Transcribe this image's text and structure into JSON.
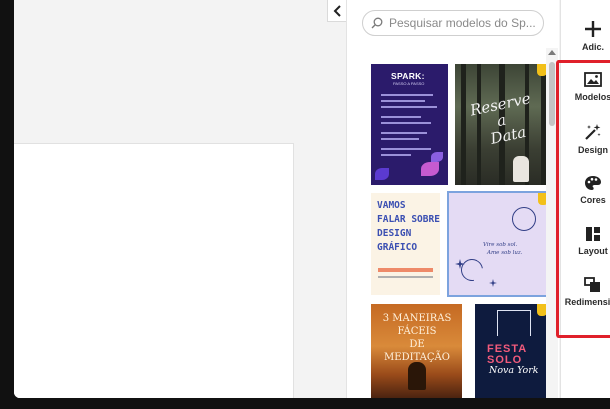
{
  "search": {
    "placeholder": "Pesquisar modelos do Sp..."
  },
  "rail": {
    "add_label": "Adic.",
    "items": [
      {
        "label": "Modelos",
        "icon": "image-icon"
      },
      {
        "label": "Design",
        "icon": "magic-wand-icon"
      },
      {
        "label": "Cores",
        "icon": "palette-icon"
      },
      {
        "label": "Layout",
        "icon": "layout-icon"
      },
      {
        "label": "Redimension",
        "icon": "resize-icon"
      }
    ]
  },
  "templates": {
    "spark": {
      "title_line1": "SPARK:",
      "title_line2": "PASSO A PASSO"
    },
    "forest": {
      "script_line1": "Reserve",
      "script_line2": "a",
      "script_line3": "Data"
    },
    "design": {
      "lines": [
        "VAMOS",
        "FALAR SOBRE",
        "DESIGN",
        "GRÁFICO"
      ]
    },
    "moon": {
      "quote_line1": "Vire sob sol.",
      "quote_line2": "Ame sob luz."
    },
    "meditation": {
      "title_line1": "3 MANEIRAS FÁCEIS",
      "title_line2": "DE MEDITAÇÃO"
    },
    "festa": {
      "festa": "FESTA",
      "solo": "SOLO",
      "nova": "Nova York"
    }
  },
  "colors": {
    "highlight": "#e0202a",
    "bookmark": "#f2c019"
  }
}
